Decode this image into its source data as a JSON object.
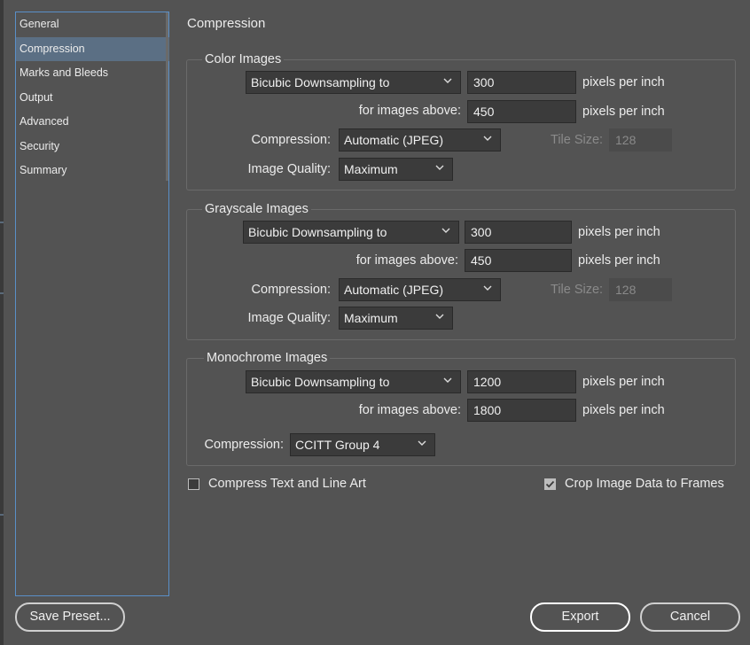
{
  "sidebar": {
    "items": [
      {
        "label": "General"
      },
      {
        "label": "Compression"
      },
      {
        "label": "Marks and Bleeds"
      },
      {
        "label": "Output"
      },
      {
        "label": "Advanced"
      },
      {
        "label": "Security"
      },
      {
        "label": "Summary"
      }
    ],
    "selected_index": 1
  },
  "page_title": "Compression",
  "color": {
    "title": "Color Images",
    "method": "Bicubic Downsampling to",
    "ppi": "300",
    "ppi_unit": "pixels per inch",
    "above_label": "for images above:",
    "above": "450",
    "above_unit": "pixels per inch",
    "compression_label": "Compression:",
    "compression": "Automatic (JPEG)",
    "tile_label": "Tile Size:",
    "tile": "128",
    "quality_label": "Image Quality:",
    "quality": "Maximum"
  },
  "grayscale": {
    "title": "Grayscale Images",
    "method": "Bicubic Downsampling to",
    "ppi": "300",
    "ppi_unit": "pixels per inch",
    "above_label": "for images above:",
    "above": "450",
    "above_unit": "pixels per inch",
    "compression_label": "Compression:",
    "compression": "Automatic (JPEG)",
    "tile_label": "Tile Size:",
    "tile": "128",
    "quality_label": "Image Quality:",
    "quality": "Maximum"
  },
  "monochrome": {
    "title": "Monochrome Images",
    "method": "Bicubic Downsampling to",
    "ppi": "1200",
    "ppi_unit": "pixels per inch",
    "above_label": "for images above:",
    "above": "1800",
    "above_unit": "pixels per inch",
    "compression_label": "Compression:",
    "compression": "CCITT Group 4"
  },
  "options": {
    "compress_text_label": "Compress Text and Line Art",
    "compress_text_checked": false,
    "crop_label": "Crop Image Data to Frames",
    "crop_checked": true
  },
  "footer": {
    "save_preset": "Save Preset...",
    "export": "Export",
    "cancel": "Cancel"
  },
  "colors": {
    "background": "#535353",
    "field": "#3b3b3b",
    "selection": "#5b6f84",
    "focus_border": "#5a8fc8"
  }
}
